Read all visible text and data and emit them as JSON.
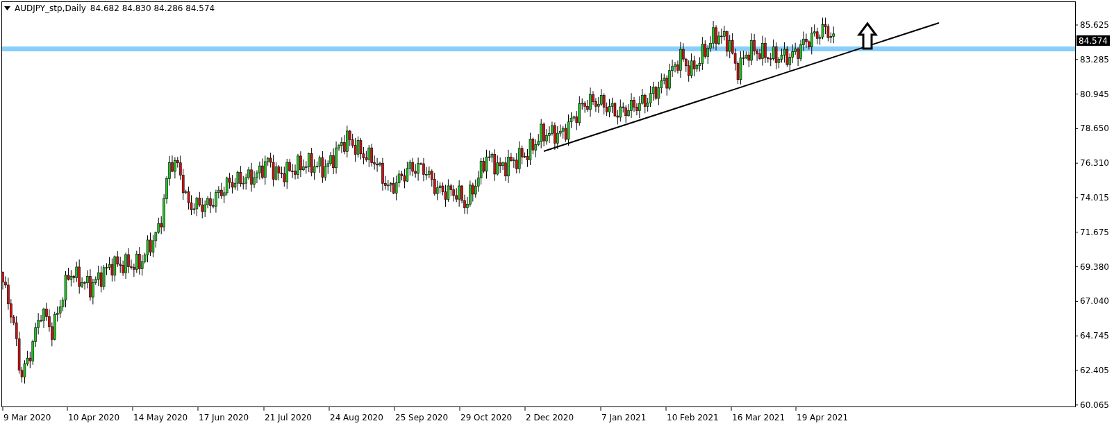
{
  "chart_header": {
    "symbol": "AUDJPY_stp,Daily",
    "ohlc": [
      "84.682",
      "84.830",
      "84.286",
      "84.574"
    ]
  },
  "price_axis": [
    "85.625",
    "83.285",
    "80.945",
    "78.650",
    "76.310",
    "74.015",
    "71.675",
    "69.380",
    "67.040",
    "64.745",
    "62.405",
    "60.065"
  ],
  "current_price": "84.574",
  "time_axis": [
    "9 Mar 2020",
    "10 Apr 2020",
    "14 May 2020",
    "17 Jun 2020",
    "21 Jul 2020",
    "24 Aug 2020",
    "25 Sep 2020",
    "29 Oct 2020",
    "2 Dec 2020",
    "7 Jan 2021",
    "10 Feb 2021",
    "16 Mar 2021",
    "19 Apr 2021"
  ]
}
